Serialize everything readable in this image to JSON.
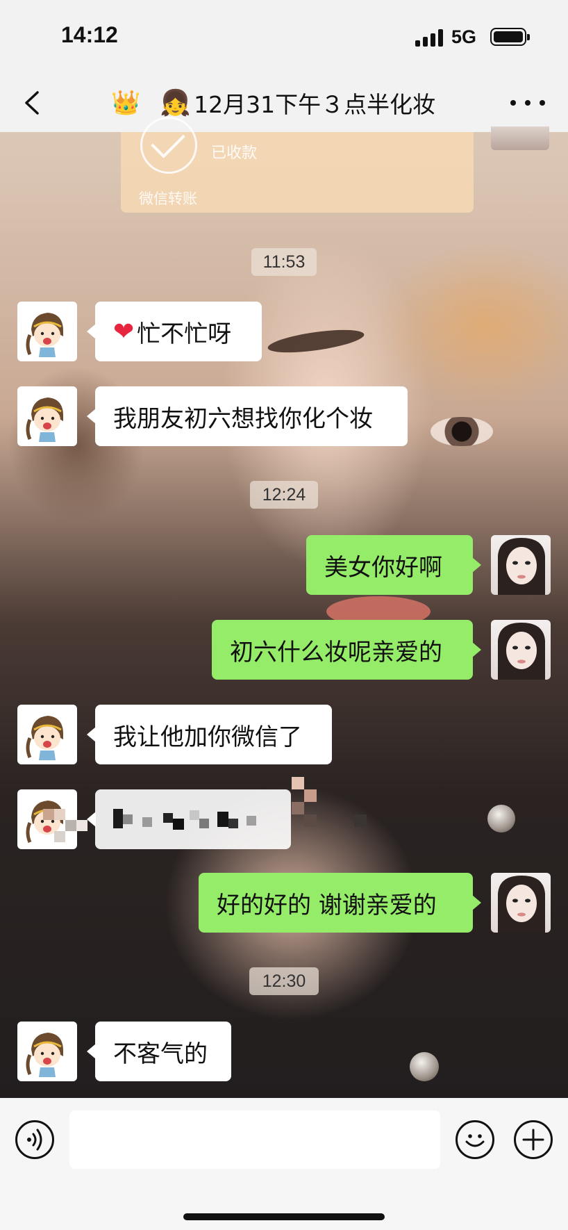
{
  "status_bar": {
    "time": "14:12",
    "network": "5G"
  },
  "nav": {
    "title_emoji_1": "👑",
    "title_emoji_2": "👧",
    "title": "12月31下午３点半化妆",
    "icons": [
      "back-icon",
      "more-icon"
    ]
  },
  "transfer": {
    "status": "已收款",
    "footer": "微信转账"
  },
  "messages": {
    "ts_1": "11:53",
    "m1": "忙不忙呀",
    "m2": "我朋友初六想找你化个妆",
    "ts_2": "12:24",
    "m3": "美女你好啊",
    "m4": "初六什么妆呢亲爱的",
    "m5": "我让他加你微信了",
    "m7": "好的好的 谢谢亲爱的",
    "ts_3": "12:30",
    "m8": "不客气的"
  },
  "input_bar": {
    "placeholder": "",
    "icons": [
      "voice-icon",
      "emoji-icon",
      "plus-icon"
    ]
  },
  "colors": {
    "outgoing_bubble": "#95ec69",
    "incoming_bubble": "#ffffff",
    "bar_background": "#f2f2f2",
    "transfer_card": "#f8dab4"
  }
}
